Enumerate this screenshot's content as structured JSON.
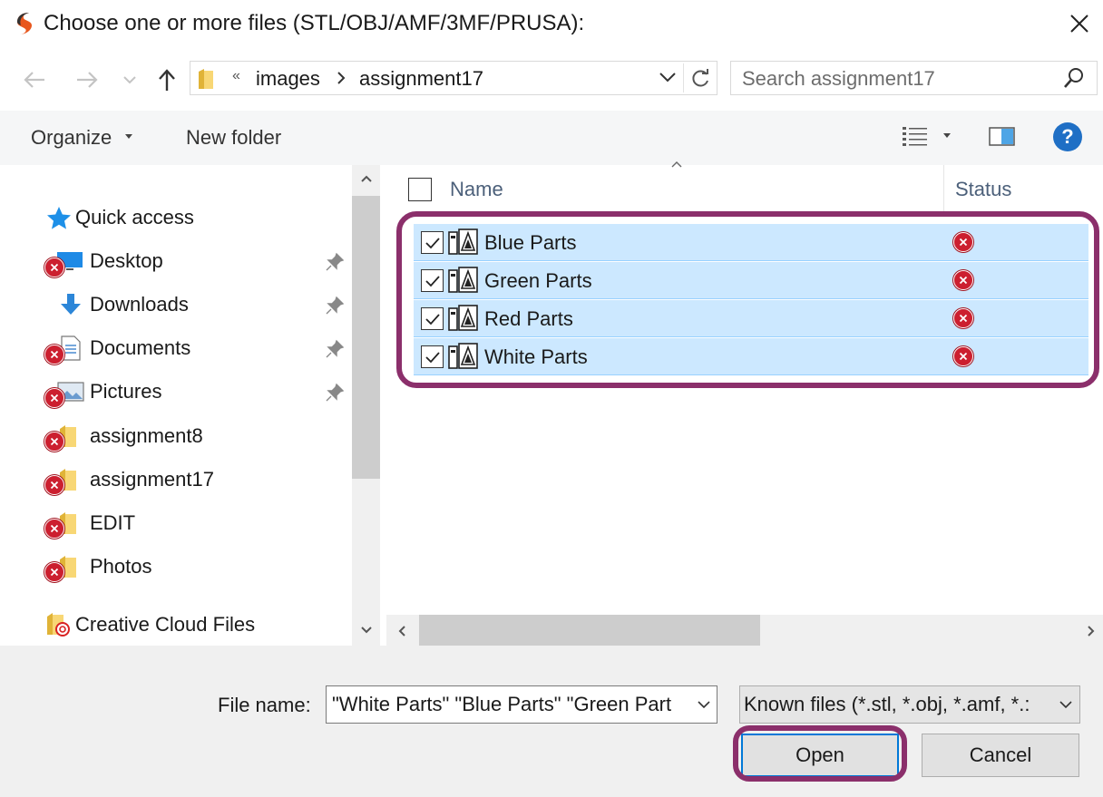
{
  "window": {
    "title": "Choose one or more files (STL/OBJ/AMF/3MF/PRUSA):"
  },
  "address": {
    "overflow_chevron": "«",
    "segments": [
      "images",
      "assignment17"
    ]
  },
  "search": {
    "placeholder": "Search assignment17"
  },
  "toolbar": {
    "organize_label": "Organize",
    "new_folder_label": "New folder"
  },
  "nav": {
    "quick_access": "Quick access",
    "items": [
      {
        "label": "Desktop",
        "icon": "desktop-icon",
        "pinned": true,
        "error": true
      },
      {
        "label": "Downloads",
        "icon": "download-arrow-icon",
        "pinned": true,
        "error": false
      },
      {
        "label": "Documents",
        "icon": "document-icon",
        "pinned": true,
        "error": true
      },
      {
        "label": "Pictures",
        "icon": "pictures-icon",
        "pinned": true,
        "error": true
      },
      {
        "label": "assignment8",
        "icon": "folder-icon",
        "pinned": false,
        "error": true
      },
      {
        "label": "assignment17",
        "icon": "folder-icon",
        "pinned": false,
        "error": true
      },
      {
        "label": "EDIT",
        "icon": "folder-icon",
        "pinned": false,
        "error": true
      },
      {
        "label": "Photos",
        "icon": "folder-icon",
        "pinned": false,
        "error": true
      }
    ],
    "creative_cloud": "Creative Cloud Files"
  },
  "file_list": {
    "columns": {
      "name": "Name",
      "status": "Status"
    },
    "rows": [
      {
        "name": "Blue Parts",
        "checked": true,
        "status": "error"
      },
      {
        "name": "Green Parts",
        "checked": true,
        "status": "error"
      },
      {
        "name": "Red Parts",
        "checked": true,
        "status": "error"
      },
      {
        "name": "White Parts",
        "checked": true,
        "status": "error"
      }
    ]
  },
  "footer": {
    "file_name_label": "File name:",
    "file_name_value": "\"White Parts\" \"Blue Parts\" \"Green Part",
    "file_type_value": "Known files (*.stl, *.obj, *.amf, *.:",
    "open_label": "Open",
    "cancel_label": "Cancel"
  },
  "colors": {
    "selection": "#cce8ff",
    "highlight_outline": "#8b2f6b",
    "error_red": "#cc1f2f",
    "help_blue": "#1f6fc5"
  }
}
